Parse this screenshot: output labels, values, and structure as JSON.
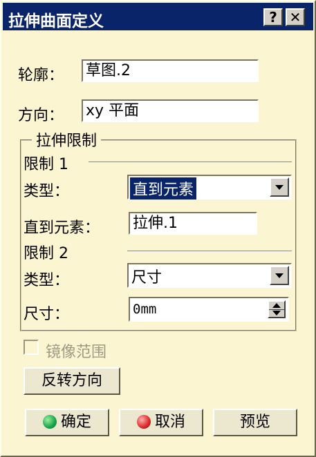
{
  "window": {
    "title": "拉伸曲面定义",
    "help_label": "?",
    "close_label": "✕"
  },
  "profile": {
    "label": "轮廓：",
    "value": "草图.2"
  },
  "direction": {
    "label": "方向：",
    "value": "xy 平面"
  },
  "extrusion_limits": {
    "legend": "拉伸限制",
    "limit1": {
      "header": "限制 1",
      "type_label": "类型：",
      "type_value": "直到元素",
      "element_label": "直到元素：",
      "element_value": "拉伸.1"
    },
    "limit2": {
      "header": "限制 2",
      "type_label": "类型：",
      "type_value": "尺寸",
      "dimension_label": "尺寸：",
      "dimension_value": "0mm"
    }
  },
  "mirrored_extent": {
    "label": "镜像范围",
    "checked": false
  },
  "reverse_direction_label": "反转方向",
  "buttons": {
    "ok": "确定",
    "cancel": "取消",
    "preview": "预览"
  },
  "colors": {
    "ok_icon": "#16a34a",
    "cancel_icon": "#dc2626",
    "title_bar": "#0a246a",
    "dialog_bg": "#fbf5d1"
  }
}
